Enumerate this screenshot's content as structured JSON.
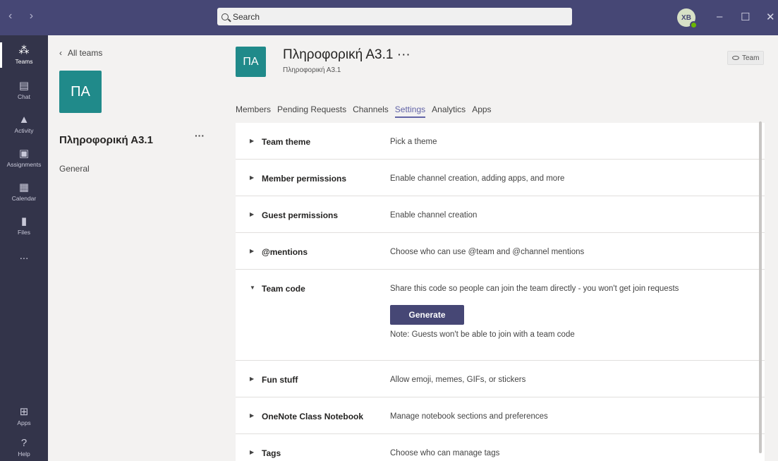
{
  "titlebar": {
    "nav": "‹ ›",
    "search_placeholder": "Search",
    "avatar_initials": "XB",
    "minimize": "–",
    "maximize": "☐",
    "close": "✕"
  },
  "rail": {
    "items": [
      {
        "label": "Teams",
        "icon": "teams-icon"
      },
      {
        "label": "Chat",
        "icon": "chat-icon"
      },
      {
        "label": "Activity",
        "icon": "bell-icon"
      },
      {
        "label": "Assignments",
        "icon": "assignments-icon"
      },
      {
        "label": "Calendar",
        "icon": "calendar-icon"
      },
      {
        "label": "Files",
        "icon": "file-icon"
      },
      {
        "label": "...",
        "icon": "more-icon"
      }
    ],
    "apps_label": "Apps",
    "help_label": "Help"
  },
  "team_panel": {
    "back_label": "All teams",
    "tile_initials": "ΠΑ",
    "team_name": "Πληροφορική Α3.1",
    "more": "···",
    "channels": [
      "General"
    ]
  },
  "main": {
    "tile_initials": "ΠΑ",
    "title": "Πληροφορική Α3.1 ···",
    "subtitle": "Πληροφορική Α3.1",
    "badge": "Team",
    "tabs": [
      "Members",
      "Pending Requests",
      "Channels",
      "Settings",
      "Analytics",
      "Apps"
    ],
    "active_tab": "Settings",
    "settings": [
      {
        "title": "Team theme",
        "desc": "Pick a theme",
        "expanded": false
      },
      {
        "title": "Member permissions",
        "desc": "Enable channel creation, adding apps, and more",
        "expanded": false
      },
      {
        "title": "Guest permissions",
        "desc": "Enable channel creation",
        "expanded": false
      },
      {
        "title": "@mentions",
        "desc": "Choose who can use @team and @channel mentions",
        "expanded": false
      },
      {
        "title": "Team code",
        "desc": "Share this code so people can join the team directly - you won't get join requests",
        "expanded": true,
        "button": "Generate",
        "note": "Note: Guests won't be able to join with a team code"
      },
      {
        "title": "Fun stuff",
        "desc": "Allow emoji, memes, GIFs, or stickers",
        "expanded": false
      },
      {
        "title": "OneNote Class Notebook",
        "desc": "Manage notebook sections and preferences",
        "expanded": false
      },
      {
        "title": "Tags",
        "desc": "Choose who can manage tags",
        "expanded": false
      }
    ]
  },
  "colors": {
    "titlebar": "#464775",
    "rail": "#33344a",
    "accent": "#6264a7",
    "team_tile": "#208a8a"
  }
}
